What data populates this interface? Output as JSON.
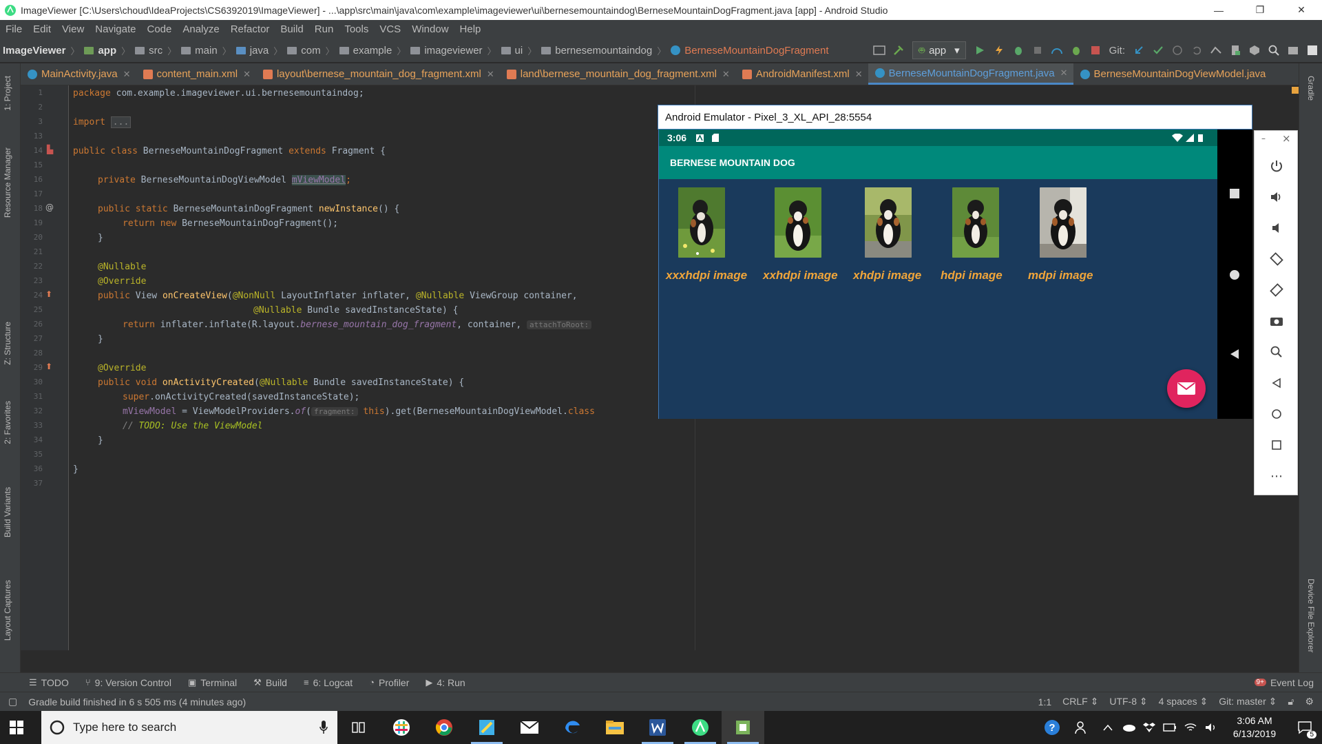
{
  "window": {
    "title": "ImageViewer [C:\\Users\\choud\\IdeaProjects\\CS6392019\\ImageViewer] - ...\\app\\src\\main\\java\\com\\example\\imageviewer\\ui\\bernesemountaindog\\BerneseMountainDogFragment.java [app] - Android Studio",
    "minimize": "—",
    "maximize": "❐",
    "close": "✕"
  },
  "menu": [
    "File",
    "Edit",
    "View",
    "Navigate",
    "Code",
    "Analyze",
    "Refactor",
    "Build",
    "Run",
    "Tools",
    "VCS",
    "Window",
    "Help"
  ],
  "breadcrumbs": [
    "ImageViewer",
    "app",
    "src",
    "main",
    "java",
    "com",
    "example",
    "imageviewer",
    "ui",
    "bernesemountaindog",
    "BerneseMountainDogFragment"
  ],
  "toolbar": {
    "run_config": "app",
    "git_label": "Git:"
  },
  "tabs": [
    {
      "label": "MainActivity.java",
      "kind": "java"
    },
    {
      "label": "content_main.xml",
      "kind": "xml"
    },
    {
      "label": "layout\\bernese_mountain_dog_fragment.xml",
      "kind": "xml"
    },
    {
      "label": "land\\bernese_mountain_dog_fragment.xml",
      "kind": "xml"
    },
    {
      "label": "AndroidManifest.xml",
      "kind": "xml"
    },
    {
      "label": "BerneseMountainDogFragment.java",
      "kind": "java",
      "active": true
    },
    {
      "label": "BerneseMountainDogViewModel.java",
      "kind": "java"
    }
  ],
  "left_tools": [
    "1: Project",
    "Resource Manager",
    "Z: Structure",
    "2: Favorites",
    "Build Variants",
    "Layout Captures"
  ],
  "right_tools": [
    "Gradle",
    "Device File Explorer"
  ],
  "line_numbers": [
    "1",
    "2",
    "3",
    "13",
    "14",
    "15",
    "16",
    "17",
    "18",
    "19",
    "20",
    "21",
    "22",
    "23",
    "24",
    "25",
    "26",
    "27",
    "28",
    "29",
    "30",
    "31",
    "32",
    "33",
    "34",
    "35",
    "36",
    "37"
  ],
  "code": {
    "l1_kw": "package",
    "l1_rest": " com.example.imageviewer.ui.bernesemountaindog;",
    "l3_kw": "import",
    "l3_fold": "...",
    "l14_kw": "public class",
    "l14_name": " BerneseMountainDogFragment ",
    "l14_ext": "extends",
    "l14_rest": " Fragment {",
    "l16_kw": "private",
    "l16_type": " BerneseMountainDogViewModel ",
    "l16_field": "mViewModel",
    "l16_end": ";",
    "l18_kw": "public static",
    "l18_type": " BerneseMountainDogFragment ",
    "l18_fn": "newInstance",
    "l18_rest": "() {",
    "l19_kw": "return new",
    "l19_rest": " BerneseMountainDogFragment();",
    "close_brace": "}",
    "l22_ann": "@Nullable",
    "l23_ann": "@Override",
    "l24_kw": "public",
    "l24_type": " View ",
    "l24_fn": "onCreateView",
    "l24_p1": "(",
    "l24_ann1": "@NonNull",
    "l24_p2": " LayoutInflater inflater, ",
    "l24_ann2": "@Nullable",
    "l24_p3": " ViewGroup container,",
    "l25_ann": "@Nullable",
    "l25_rest": " Bundle savedInstanceState) {",
    "l26_kw": "return",
    "l26_a": " inflater.inflate(R.layout.",
    "l26_it": "bernese_mountain_dog_fragment",
    "l26_b": ", container, ",
    "l26_hint": "attachToRoot:",
    "l29_ann": "@Override",
    "l30_kw": "public void",
    "l30_fn": " onActivityCreated",
    "l30_p": "(",
    "l30_ann": "@Nullable",
    "l30_rest": " Bundle savedInstanceState) {",
    "l31_kw": "super",
    "l31_rest": ".onActivityCreated(savedInstanceState);",
    "l32_field": "mViewModel",
    "l32_a": " = ViewModelProviders.",
    "l32_it": "of",
    "l32_p": "(",
    "l32_hint": "fragment:",
    "l32_kw": " this",
    "l32_b": ").get(BerneseMountainDogViewModel.",
    "l32_kw2": "class",
    "l33_cm": "// ",
    "l33_todo": "TODO: Use the ViewModel"
  },
  "emulator": {
    "title": "Android Emulator - Pixel_3_XL_API_28:5554",
    "time": "3:06",
    "app_title": "BERNESE MOUNTAIN DOG",
    "images": [
      "xxxhdpi image",
      "xxhdpi image",
      "xhdpi image",
      "hdpi image",
      "mdpi image"
    ],
    "fab_icon": "envelope-icon",
    "side_min": "–",
    "side_close": "×",
    "side_more": "⋯"
  },
  "bottom_tools": [
    {
      "label": "TODO",
      "icon": "☰"
    },
    {
      "label": "9: Version Control",
      "icon": "⑂"
    },
    {
      "label": "Terminal",
      "icon": "▣"
    },
    {
      "label": "Build",
      "icon": "⚒"
    },
    {
      "label": "6: Logcat",
      "icon": "≡"
    },
    {
      "label": "Profiler",
      "icon": "◔"
    },
    {
      "label": "4: Run",
      "icon": "▶"
    }
  ],
  "event_log": "Event Log",
  "event_badge": "9+",
  "status": {
    "message": "Gradle build finished in 6 s 505 ms (4 minutes ago)",
    "position": "1:1",
    "line_sep": "CRLF ⇕",
    "encoding": "UTF-8 ⇕",
    "indent": "4 spaces ⇕",
    "vcs": "Git: master ⇕"
  },
  "taskbar": {
    "search_placeholder": "Type here to search",
    "clock_time": "3:06 AM",
    "clock_date": "6/13/2019",
    "notif_count": "5"
  },
  "colors": {
    "ide_bg": "#2b2b2b",
    "panel_bg": "#3c3f41",
    "keyword": "#cc7832",
    "annotation": "#bbb529",
    "function": "#ffc66d",
    "field": "#9876aa",
    "app_bar": "#00897b",
    "app_content": "#1a3a5c",
    "image_label": "#f0a53a",
    "fab": "#e0245e"
  }
}
